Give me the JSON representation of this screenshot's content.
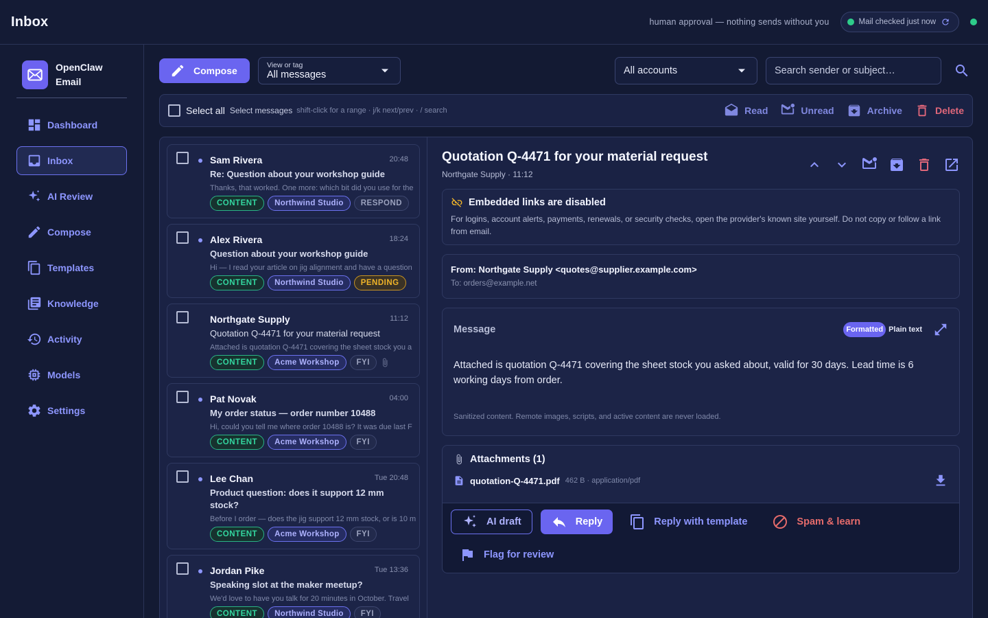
{
  "header": {
    "title": "Inbox",
    "approval_note": "human approval — nothing sends without you",
    "mail_status": "Mail checked just now"
  },
  "colors": {
    "accent": "#6a65f0",
    "success": "#2ecc8a",
    "danger": "#e0677a",
    "warning": "#f0b429"
  },
  "sidebar": {
    "brand_name": "OpenClaw Email",
    "items": [
      {
        "label": "Dashboard",
        "icon": "dashboard-icon"
      },
      {
        "label": "Inbox",
        "icon": "inbox-icon",
        "active": true
      },
      {
        "label": "AI Review",
        "icon": "sparkle-icon"
      },
      {
        "label": "Compose",
        "icon": "pencil-icon"
      },
      {
        "label": "Templates",
        "icon": "copy-icon"
      },
      {
        "label": "Knowledge",
        "icon": "library-icon"
      },
      {
        "label": "Activity",
        "icon": "history-icon"
      },
      {
        "label": "Models",
        "icon": "chip-icon"
      },
      {
        "label": "Settings",
        "icon": "gear-icon"
      }
    ]
  },
  "toolbar": {
    "compose_label": "Compose",
    "view_label": "View or tag",
    "view_value": "All messages",
    "account_value": "All accounts",
    "search_placeholder": "Search sender or subject…"
  },
  "selection": {
    "select_all": "Select all",
    "select_messages": "Select messages",
    "hint": "shift-click for a range · j/k next/prev · / search",
    "actions": {
      "read": "Read",
      "unread": "Unread",
      "archive": "Archive",
      "delete": "Delete"
    }
  },
  "messages": [
    {
      "sender": "Sam Rivera",
      "time": "20:48",
      "subject": "Re: Question about your workshop guide",
      "preview": "Thanks, that worked. One more: which bit did you use for the",
      "unread": true,
      "tags": [
        {
          "label": "CONTENT",
          "kind": "c"
        },
        {
          "label": "Northwind Studio",
          "kind": "a"
        },
        {
          "label": "RESPOND",
          "kind": "n"
        }
      ]
    },
    {
      "sender": "Alex Rivera",
      "time": "18:24",
      "subject": "Question about your workshop guide",
      "preview": "Hi — I read your article on jig alignment and have a question",
      "unread": true,
      "tags": [
        {
          "label": "CONTENT",
          "kind": "c"
        },
        {
          "label": "Northwind Studio",
          "kind": "a"
        },
        {
          "label": "PENDING",
          "kind": "p"
        }
      ]
    },
    {
      "sender": "Northgate Supply",
      "time": "11:12",
      "subject": "Quotation Q-4471 for your material request",
      "preview": "Attached is quotation Q-4471 covering the sheet stock you a",
      "unread": false,
      "attachment": true,
      "tags": [
        {
          "label": "CONTENT",
          "kind": "c"
        },
        {
          "label": "Acme Workshop",
          "kind": "a"
        },
        {
          "label": "FYI",
          "kind": "n"
        }
      ]
    },
    {
      "sender": "Pat Novak",
      "time": "04:00",
      "subject": "My order status — order number 10488",
      "preview": "Hi, could you tell me where order 10488 is? It was due last F",
      "unread": true,
      "tags": [
        {
          "label": "CONTENT",
          "kind": "c"
        },
        {
          "label": "Acme Workshop",
          "kind": "a"
        },
        {
          "label": "FYI",
          "kind": "n"
        }
      ]
    },
    {
      "sender": "Lee Chan",
      "time": "Tue 20:48",
      "subject": "Product question: does it support 12 mm stock?",
      "preview": "Before I order — does the jig support 12 mm stock, or is 10 m",
      "unread": true,
      "tags": [
        {
          "label": "CONTENT",
          "kind": "c"
        },
        {
          "label": "Acme Workshop",
          "kind": "a"
        },
        {
          "label": "FYI",
          "kind": "n"
        }
      ]
    },
    {
      "sender": "Jordan Pike",
      "time": "Tue 13:36",
      "subject": "Speaking slot at the maker meetup?",
      "preview": "We'd love to have you talk for 20 minutes in October. Travel",
      "unread": true,
      "tags": [
        {
          "label": "CONTENT",
          "kind": "c"
        },
        {
          "label": "Northwind Studio",
          "kind": "a"
        },
        {
          "label": "FYI",
          "kind": "n"
        }
      ]
    }
  ],
  "detail": {
    "title": "Quotation Q-4471 for your material request",
    "meta": "Northgate Supply · 11:12",
    "warning_title": "Embedded links are disabled",
    "warning_text": "For logins, account alerts, payments, renewals, or security checks, open the provider's known site yourself. Do not copy or follow a link from email.",
    "from": "From: Northgate Supply <quotes@supplier.example.com>",
    "to": "To: orders@example.net",
    "message_label": "Message",
    "format_formatted": "Formatted",
    "format_plain": "Plain text",
    "body": "Attached is quotation Q-4471 covering the sheet stock you asked about, valid for 30 days. Lead time is 6 working days from order.",
    "sanitized_note": "Sanitized content. Remote images, scripts, and active content are never loaded.",
    "attachments_label": "Attachments (1)",
    "attachment_name": "quotation-Q-4471.pdf",
    "attachment_meta": "462 B · application/pdf"
  },
  "actions": {
    "ai_draft": "AI draft",
    "reply": "Reply",
    "reply_template": "Reply with template",
    "spam": "Spam & learn",
    "flag": "Flag for review"
  }
}
